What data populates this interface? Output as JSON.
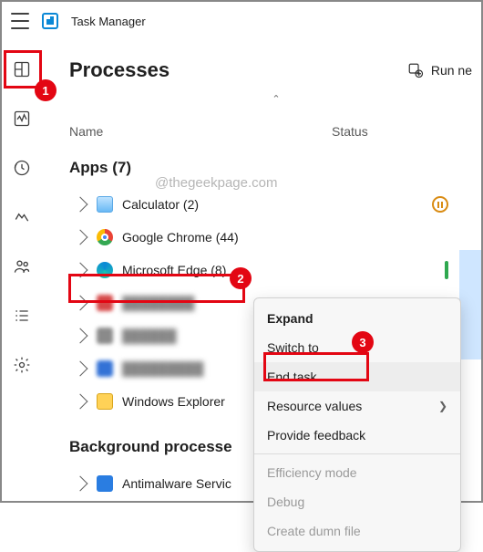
{
  "app": {
    "title": "Task Manager"
  },
  "page": {
    "title": "Processes",
    "run_new_label": "Run ne"
  },
  "columns": {
    "name": "Name",
    "status": "Status",
    "sort_indicator": "⌃"
  },
  "sections": {
    "apps": "Apps (7)",
    "background": "Background processe"
  },
  "apps": [
    {
      "label": "Calculator (2)"
    },
    {
      "label": "Google Chrome (44)"
    },
    {
      "label": "Microsoft Edge (8)"
    },
    {
      "label": ""
    },
    {
      "label": ""
    },
    {
      "label": ""
    },
    {
      "label": "Windows Explorer"
    }
  ],
  "bg": [
    {
      "label": "Antimalware Servic"
    }
  ],
  "context_menu": {
    "expand": "Expand",
    "switch_to": "Switch to",
    "end_task": "End task",
    "resource_values": "Resource values",
    "provide_feedback": "Provide feedback",
    "efficiency_mode": "Efficiency mode",
    "debug": "Debug",
    "create_dump": "Create dumn file"
  },
  "watermark": "@thegeekpage.com",
  "annotations": {
    "b1": "1",
    "b2": "2",
    "b3": "3"
  }
}
